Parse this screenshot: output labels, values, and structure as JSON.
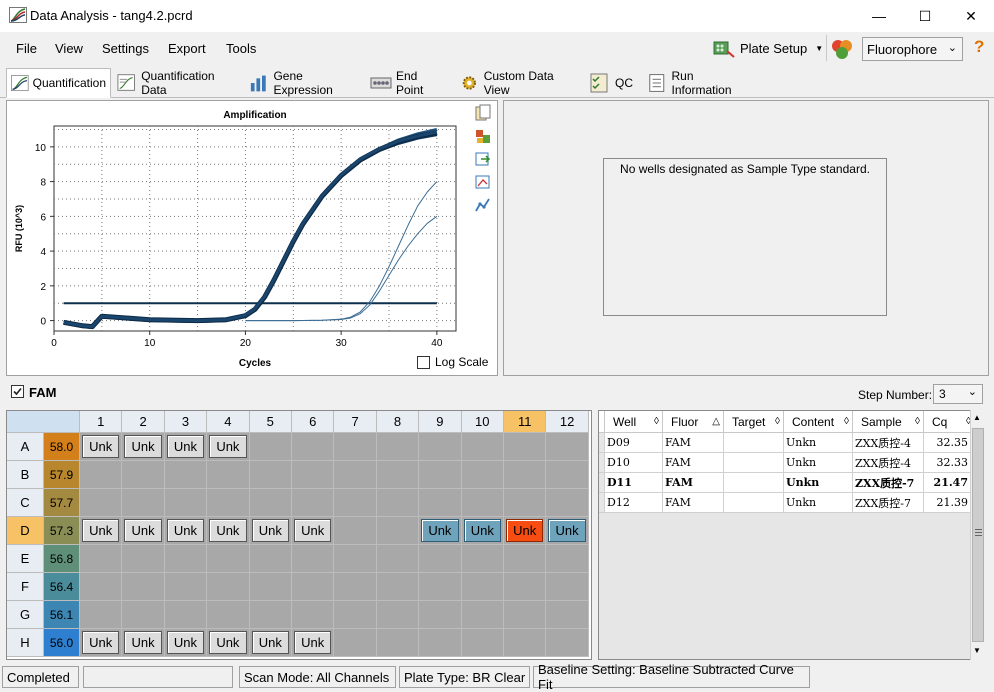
{
  "window": {
    "title": "Data Analysis - tang4.2.pcrd",
    "minimize": "—",
    "maximize": "☐",
    "close": "✕"
  },
  "menu": {
    "items": [
      {
        "label": "File"
      },
      {
        "label": "View"
      },
      {
        "label": "Settings"
      },
      {
        "label": "Export"
      },
      {
        "label": "Tools"
      }
    ],
    "plate_setup": "Plate Setup",
    "fluorophore": "Fluorophore",
    "help": "?"
  },
  "tabs": [
    {
      "label": "Quantification",
      "icon": "amplification-chart-icon"
    },
    {
      "label": "Quantification Data",
      "icon": "data-sheet-icon"
    },
    {
      "label": "Gene Expression",
      "icon": "bar-chart-icon"
    },
    {
      "label": "End Point",
      "icon": "end-point-icon"
    },
    {
      "label": "Custom Data View",
      "icon": "gear-icon"
    },
    {
      "label": "QC",
      "icon": "checklist-icon"
    },
    {
      "label": "Run Information",
      "icon": "document-icon"
    }
  ],
  "chart_data": {
    "type": "line",
    "title": "Amplification",
    "xlabel": "Cycles",
    "ylabel": "RFU (10^3)",
    "xlim": [
      0,
      42
    ],
    "ylim": [
      -0.6,
      11.2
    ],
    "xticks": [
      0,
      10,
      20,
      30,
      40
    ],
    "yticks": [
      0,
      2,
      4,
      6,
      8,
      10
    ],
    "grid": true,
    "threshold": 1.0,
    "log_scale_label": "Log Scale",
    "log_scale": false,
    "series": [
      {
        "well": "D09",
        "color": "#1f4f7a",
        "x": [
          1,
          3,
          4,
          5,
          10,
          15,
          18,
          20,
          21,
          22,
          23,
          24,
          25,
          26,
          28,
          30,
          32,
          34,
          36,
          38,
          40
        ],
        "y": [
          -0.1,
          -0.3,
          -0.35,
          0.25,
          0.05,
          0.0,
          0.05,
          0.3,
          0.7,
          1.4,
          2.4,
          3.5,
          4.6,
          5.6,
          7.2,
          8.4,
          9.3,
          9.9,
          10.4,
          10.75,
          11.0
        ]
      },
      {
        "well": "D10",
        "color": "#123a60",
        "x": [
          1,
          3,
          4,
          5,
          10,
          15,
          18,
          20,
          21,
          22,
          23,
          24,
          25,
          26,
          28,
          30,
          32,
          34,
          36,
          38,
          40
        ],
        "y": [
          -0.15,
          -0.35,
          -0.4,
          0.2,
          0.0,
          -0.05,
          0.0,
          0.25,
          0.6,
          1.3,
          2.3,
          3.4,
          4.5,
          5.5,
          7.1,
          8.3,
          9.2,
          9.8,
          10.2,
          10.5,
          10.7
        ]
      },
      {
        "well": "D11",
        "color": "#0d2a46",
        "x": [
          1,
          3,
          4,
          5,
          10,
          15,
          18,
          20,
          21,
          22,
          23,
          24,
          25,
          26,
          28,
          30,
          32,
          34,
          36,
          38,
          40
        ],
        "y": [
          -0.1,
          -0.3,
          -0.35,
          0.25,
          0.05,
          0.0,
          0.05,
          0.28,
          0.65,
          1.35,
          2.35,
          3.45,
          4.55,
          5.55,
          7.15,
          8.35,
          9.25,
          9.85,
          10.3,
          10.6,
          10.8
        ]
      },
      {
        "well": "D12",
        "color": "#1a456d",
        "x": [
          1,
          3,
          4,
          5,
          10,
          15,
          18,
          20,
          21,
          22,
          23,
          24,
          25,
          26,
          28,
          30,
          32,
          34,
          36,
          38,
          40
        ],
        "y": [
          -0.1,
          -0.3,
          -0.35,
          0.25,
          0.05,
          0.0,
          0.05,
          0.3,
          0.68,
          1.38,
          2.38,
          3.48,
          4.58,
          5.58,
          7.18,
          8.38,
          9.28,
          9.88,
          10.33,
          10.62,
          10.85
        ]
      },
      {
        "well": "late-1",
        "color": "#3a6d96",
        "x": [
          20,
          25,
          28,
          30,
          31,
          32,
          33,
          34,
          35,
          36,
          37,
          38,
          39,
          40
        ],
        "y": [
          0.0,
          0.0,
          0.02,
          0.08,
          0.2,
          0.5,
          1.1,
          2.0,
          3.1,
          4.3,
          5.5,
          6.6,
          7.4,
          8.0
        ]
      },
      {
        "well": "late-2",
        "color": "#3a6d96",
        "x": [
          20,
          25,
          28,
          30,
          31,
          32,
          33,
          34,
          35,
          36,
          37,
          38,
          39,
          40
        ],
        "y": [
          0.0,
          0.0,
          0.02,
          0.06,
          0.15,
          0.4,
          0.9,
          1.7,
          2.6,
          3.5,
          4.3,
          5.0,
          5.6,
          6.0
        ]
      }
    ]
  },
  "standard_panel": {
    "message": "No wells designated as Sample Type standard."
  },
  "fluor_section": {
    "label": "FAM",
    "checked": true,
    "step_label": "Step Number:",
    "step_value": "3"
  },
  "plate": {
    "columns": [
      "1",
      "2",
      "3",
      "4",
      "5",
      "6",
      "7",
      "8",
      "9",
      "10",
      "11",
      "12"
    ],
    "highlight_column": "11",
    "rows": [
      {
        "label": "A",
        "temp": "58.0",
        "temp_color": "#d37f1a",
        "wells": [
          "Unk",
          "Unk",
          "Unk",
          "Unk",
          "",
          "",
          "",
          "",
          "",
          "",
          "",
          ""
        ]
      },
      {
        "label": "B",
        "temp": "57.9",
        "temp_color": "#b8862c",
        "wells": [
          "",
          "",
          "",
          "",
          "",
          "",
          "",
          "",
          "",
          "",
          "",
          ""
        ]
      },
      {
        "label": "C",
        "temp": "57.7",
        "temp_color": "#a48a40",
        "wells": [
          "",
          "",
          "",
          "",
          "",
          "",
          "",
          "",
          "",
          "",
          "",
          ""
        ]
      },
      {
        "label": "D",
        "temp": "57.3",
        "temp_color": "#8a8e55",
        "wells": [
          "Unk",
          "Unk",
          "Unk",
          "Unk",
          "Unk",
          "Unk",
          "",
          "",
          "Unk",
          "Unk",
          "Unk",
          "Unk"
        ],
        "highlight": true
      },
      {
        "label": "E",
        "temp": "56.8",
        "temp_color": "#5f8f79",
        "wells": [
          "",
          "",
          "",
          "",
          "",
          "",
          "",
          "",
          "",
          "",
          "",
          ""
        ]
      },
      {
        "label": "F",
        "temp": "56.4",
        "temp_color": "#4a8c9a",
        "wells": [
          "",
          "",
          "",
          "",
          "",
          "",
          "",
          "",
          "",
          "",
          "",
          ""
        ]
      },
      {
        "label": "G",
        "temp": "56.1",
        "temp_color": "#3d86b4",
        "wells": [
          "",
          "",
          "",
          "",
          "",
          "",
          "",
          "",
          "",
          "",
          "",
          ""
        ]
      },
      {
        "label": "H",
        "temp": "56.0",
        "temp_color": "#2f7fd0",
        "wells": [
          "Unk",
          "Unk",
          "Unk",
          "Unk",
          "Unk",
          "Unk",
          "",
          "",
          "",
          "",
          "",
          ""
        ]
      }
    ]
  },
  "results_table": {
    "columns": [
      "Well",
      "Fluor",
      "Target",
      "Content",
      "Sample",
      "Cq"
    ],
    "rows": [
      {
        "well": "D09",
        "fluor": "FAM",
        "target": "",
        "content": "Unkn",
        "sample": "ZXX质控-4",
        "cq": "32.35"
      },
      {
        "well": "D10",
        "fluor": "FAM",
        "target": "",
        "content": "Unkn",
        "sample": "ZXX质控-4",
        "cq": "32.33"
      },
      {
        "well": "D11",
        "fluor": "FAM",
        "target": "",
        "content": "Unkn",
        "sample": "ZXX质控-7",
        "cq": "21.47"
      },
      {
        "well": "D12",
        "fluor": "FAM",
        "target": "",
        "content": "Unkn",
        "sample": "ZXX质控-7",
        "cq": "21.39"
      }
    ]
  },
  "status": {
    "state": "Completed",
    "scan_mode": "Scan Mode: All Channels",
    "plate_type": "Plate Type: BR Clear",
    "baseline": "Baseline Setting: Baseline Subtracted Curve Fit"
  }
}
